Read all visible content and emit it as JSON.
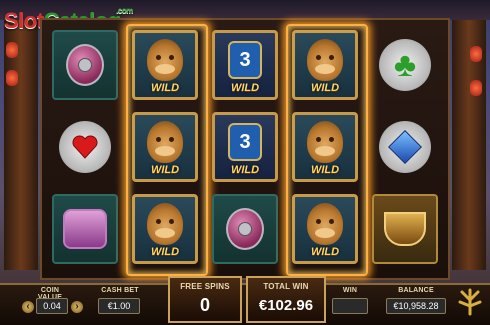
{
  "watermark": {
    "part1": "Slot",
    "part2": "Catalog",
    "suffix": ".com"
  },
  "reels": {
    "columns": [
      [
        "potion-symbol",
        "heart-symbol",
        "genie-lamp-symbol"
      ],
      [
        "monkey-wild",
        "monkey-wild",
        "monkey-wild"
      ],
      [
        "wild-3x",
        "wild-3x",
        "potion-symbol"
      ],
      [
        "monkey-wild",
        "monkey-wild",
        "monkey-wild"
      ],
      [
        "club-symbol",
        "diamond-symbol",
        "golden-bowl-symbol"
      ]
    ],
    "wild_label": "WILD",
    "multiplier_label": "3"
  },
  "bottom": {
    "coin_value_label": "COIN VALUE",
    "coin_value": "0.04",
    "cash_bet_label": "CASH BET",
    "cash_bet": "€1.00",
    "free_spins_label": "FREE SPINS",
    "free_spins": "0",
    "total_win_label": "TOTAL WIN",
    "total_win": "€102.96",
    "win_label": "WIN",
    "win": "",
    "balance_label": "BALANCE",
    "balance": "€10,958.28"
  },
  "colors": {
    "accent_gold": "#c9a35a",
    "flame": "#ffb040"
  }
}
